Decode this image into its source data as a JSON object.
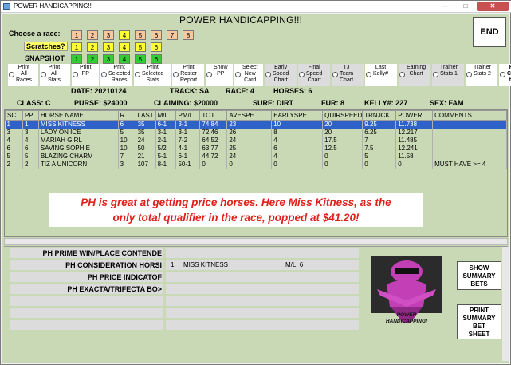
{
  "window": {
    "title": "POWER HANDICAPPING!!",
    "close_label": "✕",
    "min_label": "—",
    "max_label": "□"
  },
  "app": {
    "title": "POWER HANDICAPPING!!!",
    "end_label": "END"
  },
  "choose_race": {
    "label": "Choose  a race:",
    "buttons": [
      "1",
      "2",
      "3",
      "4",
      "5",
      "6",
      "7",
      "8"
    ],
    "selected": "4"
  },
  "scratches": {
    "label": "Scratches?",
    "buttons": [
      "1",
      "2",
      "3",
      "4",
      "5",
      "6"
    ]
  },
  "snapshot": {
    "label": "SNAPSHOT",
    "buttons": [
      "1",
      "2",
      "3",
      "4",
      "5",
      "6"
    ]
  },
  "options": [
    {
      "label": "Print\nAll\nRaces"
    },
    {
      "label": "Print\nAll\nStats"
    },
    {
      "label": "Print\nPP"
    },
    {
      "label": "Print\nSelected\nRaces"
    },
    {
      "label": "Print\nSelected\nStats"
    },
    {
      "label": "Print\nRoster\nReport"
    },
    {
      "label": "Show\nPP"
    },
    {
      "label": "Select\nNew\nCard"
    },
    {
      "label": "Early\nSpeed\nChart"
    },
    {
      "label": "Final\nSpeed\nChart"
    },
    {
      "label": "TJ\nTeam\nChart"
    },
    {
      "label": "Last\nKelly#"
    },
    {
      "label": "Earning\nChart"
    },
    {
      "label": "Trainer\nStats 1"
    },
    {
      "label": "Trainer\nStats 2"
    },
    {
      "label": "Race\nCondi-\ntions"
    }
  ],
  "race_info": {
    "date": "DATE: 20210124",
    "track": "TRACK: SA",
    "race": "RACE: 4",
    "horses": "HORSES: 6",
    "class": "CLASS: C",
    "purse": "PURSE: $24000",
    "claiming": "CLAIMING: $20000",
    "surf": "SURF: DIRT",
    "fur": "FUR: 8",
    "kelly": "KELLY#: 227",
    "sex": "SEX: FAM"
  },
  "table": {
    "columns": [
      "SC",
      "PP",
      "HORSE NAME",
      "R",
      "LAST",
      "M/L",
      "PM/L",
      "TOT",
      "AVESPE...",
      "EARLYSPE...",
      "QUIRSPEED",
      "TRNJCK",
      "POWER",
      "COMMENTS"
    ],
    "rows": [
      [
        "1",
        "1",
        "MISS KITNESS",
        "6",
        "35",
        "6-1",
        "3-1",
        "74.84",
        "23",
        "10",
        "20",
        "9.25",
        "11.738",
        ""
      ],
      [
        "3",
        "3",
        "LADY ON ICE",
        "5",
        "35",
        "3-1",
        "3-1",
        "72.46",
        "26",
        "8",
        "20",
        "6.25",
        "12.217",
        ""
      ],
      [
        "4",
        "4",
        "MARIAH GIRL",
        "10",
        "24",
        "2-1",
        "7-2",
        "64.52",
        "24",
        "4",
        "17.5",
        "7",
        "11.485",
        ""
      ],
      [
        "6",
        "6",
        "SAVING SOPHIE",
        "10",
        "50",
        "5/2",
        "4-1",
        "63.77",
        "25",
        "6",
        "12.5",
        "7.5",
        "12.241",
        ""
      ],
      [
        "5",
        "5",
        "BLAZING CHARM",
        "7",
        "21",
        "5-1",
        "6-1",
        "44.72",
        "24",
        "4",
        "0",
        "5",
        "11.58",
        ""
      ],
      [
        "2",
        "2",
        "TIZ A UNICORN",
        "3",
        "107",
        "8-1",
        "50-1",
        "0",
        "0",
        "0",
        "0",
        "0",
        "0",
        "MUST HAVE >= 4"
      ]
    ]
  },
  "banner": {
    "line1": "PH is great at getting price horses.  Here Miss Kitness, as the",
    "line2": "only total qualifier in the race, popped at $41.20!"
  },
  "bottom": {
    "labels": [
      "PH PRIME WIN/PLACE CONTENDE",
      "PH CONSIDERATION HORSI",
      "PH PRICE INDICATOF",
      "PH EXACTA/TRIFECTA BO>",
      "",
      "",
      ""
    ],
    "consideration": {
      "num": "1",
      "horse": "MISS KITNESS",
      "ml": "M/L: 6"
    },
    "logo_text": "POWER\nHANDICAPPING!",
    "show_summary": "SHOW\nSUMMARY\nBETS",
    "print_summary": "PRINT\nSUMMARY\nBET\nSHEET"
  },
  "colors": {
    "background": "#c9d9b5",
    "selection": "#2f62c8",
    "banner_text": "#e0201a"
  }
}
